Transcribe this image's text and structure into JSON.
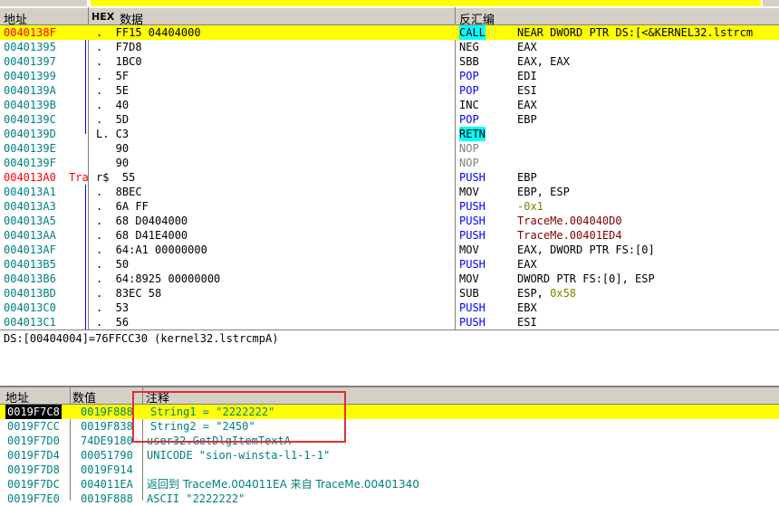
{
  "disasm": {
    "headers": {
      "address": "地址",
      "hex_tag": "HEX",
      "hex": "数据",
      "disasm": "反汇编"
    },
    "rows": [
      {
        "addr": "0040138F",
        "tag": "",
        "hex": ".  FF15 04404000",
        "mnem": "CALL",
        "ops": "NEAR DWORD PTR DS:[<&KERNEL32.lstrcm",
        "current": true
      },
      {
        "addr": "00401395",
        "tag": "",
        "hex": ".  F7D8",
        "mnem": "NEG",
        "ops": "EAX"
      },
      {
        "addr": "00401397",
        "tag": "",
        "hex": ".  1BC0",
        "mnem": "SBB",
        "ops": "EAX, EAX"
      },
      {
        "addr": "00401399",
        "tag": "",
        "hex": ".  5F",
        "mnem": "POP",
        "ops": "EDI"
      },
      {
        "addr": "0040139A",
        "tag": "",
        "hex": ".  5E",
        "mnem": "POP",
        "ops": "ESI"
      },
      {
        "addr": "0040139B",
        "tag": "",
        "hex": ".  40",
        "mnem": "INC",
        "ops": "EAX"
      },
      {
        "addr": "0040139C",
        "tag": "",
        "hex": ".  5D",
        "mnem": "POP",
        "ops": "EBP"
      },
      {
        "addr": "0040139D",
        "tag": "",
        "hex": "L. C3",
        "mnem": "RETN",
        "ops": ""
      },
      {
        "addr": "0040139E",
        "tag": "",
        "hex": "   90",
        "mnem": "NOP",
        "ops": ""
      },
      {
        "addr": "0040139F",
        "tag": "",
        "hex": "   90",
        "mnem": "NOP",
        "ops": ""
      },
      {
        "addr": "004013A0",
        "tag": "Tra",
        "hex": "r$  55",
        "mnem": "PUSH",
        "ops": "EBP"
      },
      {
        "addr": "004013A1",
        "tag": "",
        "hex": ".  8BEC",
        "mnem": "MOV",
        "ops": "EBP, ESP"
      },
      {
        "addr": "004013A3",
        "tag": "",
        "hex": ".  6A FF",
        "mnem": "PUSH",
        "ops": "-0x1"
      },
      {
        "addr": "004013A5",
        "tag": "",
        "hex": ".  68 D0404000",
        "mnem": "PUSH",
        "ops": "TraceMe.004040D0"
      },
      {
        "addr": "004013AA",
        "tag": "",
        "hex": ".  68 D41E4000",
        "mnem": "PUSH",
        "ops": "TraceMe.00401ED4"
      },
      {
        "addr": "004013AF",
        "tag": "",
        "hex": ".  64:A1 00000000",
        "mnem": "MOV",
        "ops": "EAX, DWORD PTR FS:[0]"
      },
      {
        "addr": "004013B5",
        "tag": "",
        "hex": ".  50",
        "mnem": "PUSH",
        "ops": "EAX"
      },
      {
        "addr": "004013B6",
        "tag": "",
        "hex": ".  64:8925 00000000",
        "mnem": "MOV",
        "ops": "DWORD PTR FS:[0], ESP"
      },
      {
        "addr": "004013BD",
        "tag": "",
        "hex": ".  83EC 58",
        "mnem": "SUB",
        "ops": "ESP, 0x58"
      },
      {
        "addr": "004013C0",
        "tag": "",
        "hex": ".  53",
        "mnem": "PUSH",
        "ops": "EBX"
      },
      {
        "addr": "004013C1",
        "tag": "",
        "hex": ".  56",
        "mnem": "PUSH",
        "ops": "ESI"
      }
    ]
  },
  "info": {
    "line": "DS:[00404004]=76FFCC30 (kernel32.lstrcmpA)"
  },
  "stack": {
    "headers": {
      "address": "地址",
      "value": "数值",
      "comment": "注释"
    },
    "rows": [
      {
        "addr": "0019F7C8",
        "val": "0019F888",
        "comment": "String1 = \"2222222\"",
        "selected": true
      },
      {
        "addr": "0019F7CC",
        "val": "0019F838",
        "comment": "String2 = \"2450\""
      },
      {
        "addr": "0019F7D0",
        "val": "74DE9180",
        "comment": "user32.GetDlgItemTextA"
      },
      {
        "addr": "0019F7D4",
        "val": "00051790",
        "comment": "UNICODE \"sion-winsta-l1-1-1\""
      },
      {
        "addr": "0019F7D8",
        "val": "0019F914",
        "comment": ""
      },
      {
        "addr": "0019F7DC",
        "val": "004011EA",
        "comment": "返回到 TraceMe.004011EA 来自 TraceMe.00401340"
      },
      {
        "addr": "0019F7E0",
        "val": "0019F888",
        "comment": "ASCII \"2222222\""
      }
    ]
  }
}
